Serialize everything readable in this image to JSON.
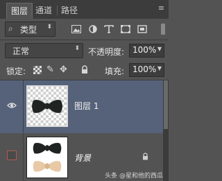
{
  "tabs": [
    {
      "label": "图层",
      "active": true
    },
    {
      "label": "通道",
      "active": false
    },
    {
      "label": "路径",
      "active": false
    }
  ],
  "filter": {
    "kind_label": "类型",
    "search_symbol": "⌕",
    "icons": [
      "image-filter-icon",
      "adjustment-filter-icon",
      "type-filter-icon",
      "shape-filter-icon",
      "smart-object-filter-icon"
    ]
  },
  "blend": {
    "mode": "正常",
    "opacity_label": "不透明度:",
    "opacity_value": "100%"
  },
  "locks": {
    "label": "锁定:",
    "fill_label": "填充:",
    "fill_value": "100%"
  },
  "layers": [
    {
      "name": "图层 1",
      "visible": true,
      "selected": true,
      "locked": false
    },
    {
      "name": "背景",
      "visible": false,
      "selected": false,
      "locked": true
    }
  ],
  "watermark": "头条 @星和他的西瓜",
  "colors": {
    "panel_bg": "#535353",
    "selected_layer": "#56627a",
    "bow_dark": "#1f2322",
    "bow_light": "#e8c9a6"
  }
}
